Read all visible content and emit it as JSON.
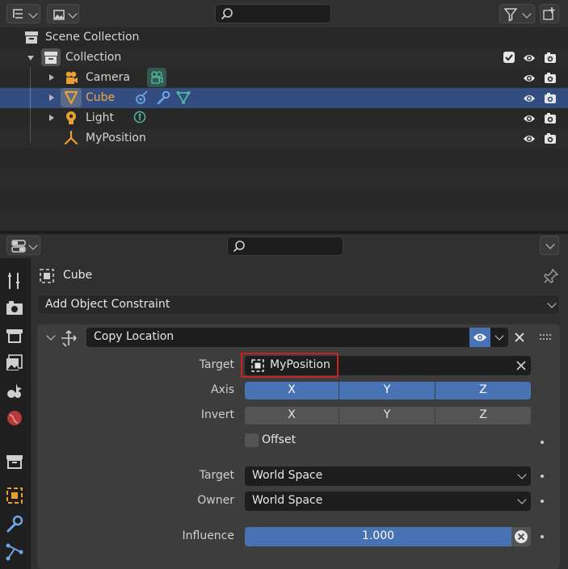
{
  "outliner": {
    "root_label": "Scene Collection",
    "collection_label": "Collection",
    "items": [
      {
        "label": "Camera"
      },
      {
        "label": "Cube"
      },
      {
        "label": "Light"
      },
      {
        "label": "MyPosition"
      }
    ]
  },
  "properties": {
    "object_name": "Cube",
    "add_constraint_label": "Add Object Constraint",
    "constraint": {
      "name": "Copy Location",
      "target_label": "Target",
      "target_value": "MyPosition",
      "axis_label": "Axis",
      "axis_buttons": [
        "X",
        "Y",
        "Z"
      ],
      "invert_label": "Invert",
      "invert_buttons": [
        "X",
        "Y",
        "Z"
      ],
      "offset_label": "Offset",
      "target_space_label": "Target",
      "target_space_value": "World Space",
      "owner_space_label": "Owner",
      "owner_space_value": "World Space",
      "influence_label": "Influence",
      "influence_value": "1.000"
    }
  },
  "colors": {
    "selection": "#334d80",
    "accent_blue": "#4772b3",
    "highlight_orange": "#e8a033",
    "data_teal": "#4fb8a0",
    "modifier_blue": "#6ea6e6",
    "annotation_red": "#cc2222"
  }
}
